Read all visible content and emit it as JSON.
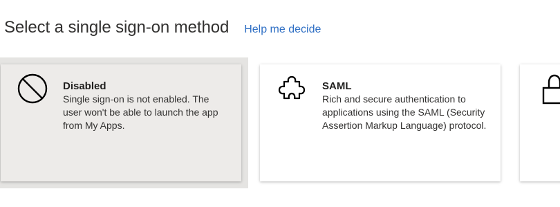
{
  "header": {
    "title": "Select a single sign-on method",
    "help_link": "Help me decide"
  },
  "cards": [
    {
      "title": "Disabled",
      "description": "Single sign-on is not enabled. The user won't be able to launch the app from My Apps.",
      "icon": "prohibited-icon",
      "selected": true
    },
    {
      "title": "SAML",
      "description": "Rich and secure authentication to applications using the SAML (Security Assertion Markup Language) protocol.",
      "icon": "puzzle-icon",
      "selected": false
    },
    {
      "icon": "lock-icon",
      "selected": false
    }
  ]
}
